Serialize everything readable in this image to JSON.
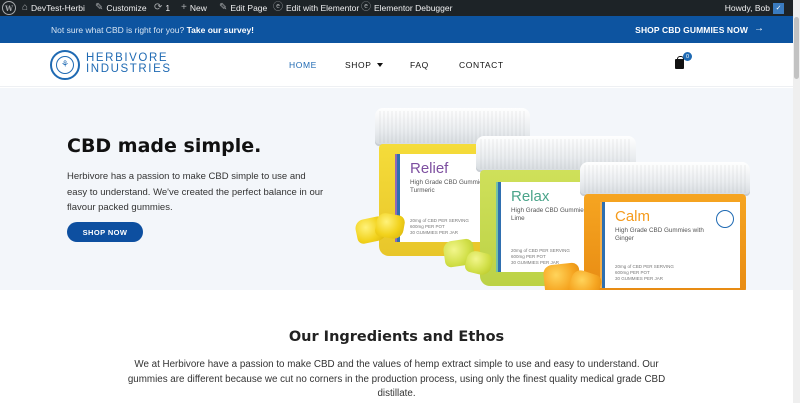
{
  "admin_bar": {
    "site_name": "DevTest-Herbi",
    "customize_label": "Customize",
    "updates_count": "1",
    "new_label": "New",
    "edit_page_label": "Edit Page",
    "edit_elementor_label": "Edit with Elementor",
    "debugger_label": "Elementor Debugger",
    "greeting": "Howdy, Bob"
  },
  "announcement": {
    "text": "Not sure what CBD is right for you?",
    "link": "Take our survey!",
    "shop_label": "SHOP CBD GUMMIES NOW",
    "shop_arrow": "→"
  },
  "header": {
    "brand_line1": "HERBIVORE",
    "brand_line2": "INDUSTRIES",
    "nav": {
      "home": "HOME",
      "shop": "SHOP",
      "faq": "FAQ",
      "contact": "CONTACT"
    },
    "cart_count": "0",
    "accent_color": "#1f6ab3"
  },
  "hero": {
    "title": "CBD made simple.",
    "body": "Herbivore has a passion to make CBD simple to use and easy to understand. We've created the perfect balance in our flavour packed gummies.",
    "button_label": "SHOP NOW",
    "jars": [
      {
        "name": "Relief",
        "subtitle": "High Grade CBD Gummies with Turmeric",
        "fine_print": "20mg of CBD PER SERVING\n600mg PER POT\n30 GUMMIES PER JAR"
      },
      {
        "name": "Relax",
        "subtitle": "High Grade CBD Gummies with Lime",
        "fine_print": "20mg of CBD PER SERVING\n600mg PER POT\n30 GUMMIES PER JAR"
      },
      {
        "name": "Calm",
        "subtitle": "High Grade CBD Gummies with Ginger",
        "fine_print": "20mg of CBD PER SERVING\n600mg PER POT\n30 GUMMIES PER JAR"
      }
    ]
  },
  "ingredients": {
    "title": "Our Ingredients and Ethos",
    "body": "We at Herbivore have a passion to make CBD and the values of hemp extract simple to use and easy to understand. Our gummies are different because we cut no corners in the production process, using only the finest quality medical grade CBD distillate."
  }
}
